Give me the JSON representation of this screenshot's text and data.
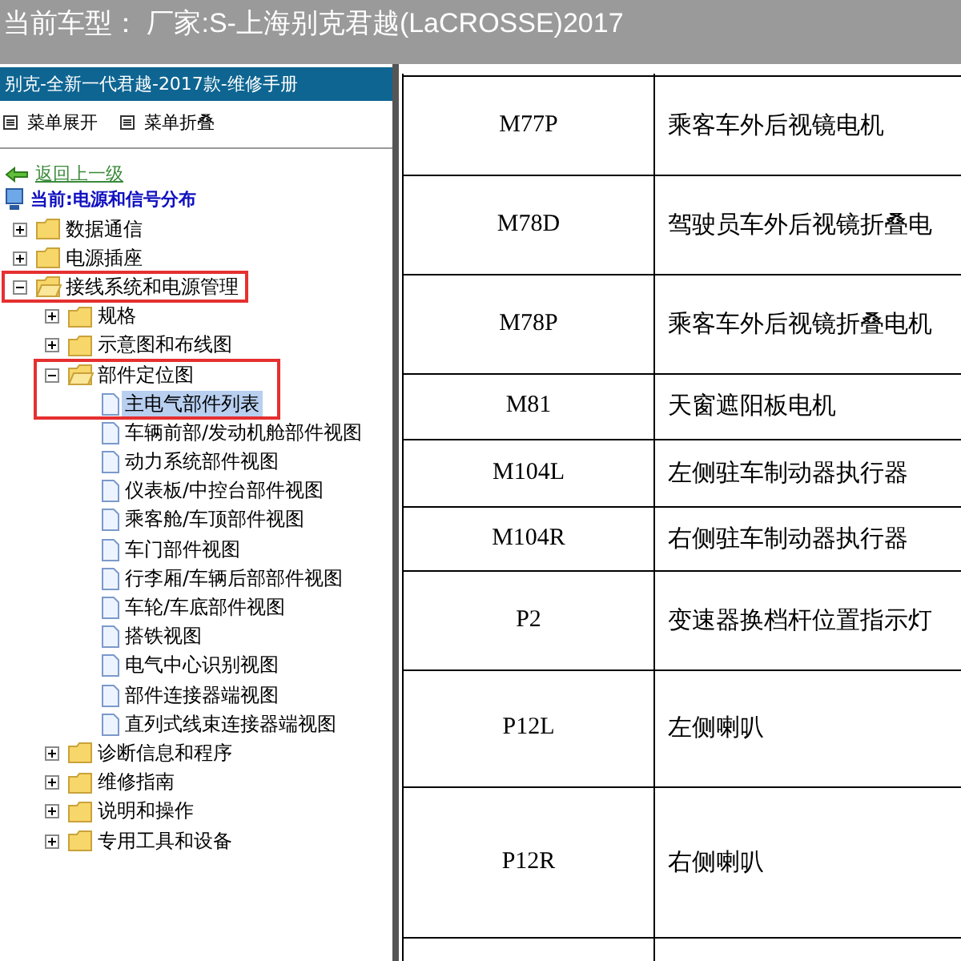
{
  "top_bar": {
    "title": "当前车型：  厂家:S-上海别克君越(LaCROSSE)2017"
  },
  "sidebar": {
    "title": "别克-全新一代君越-2017款-维修手册",
    "menu_actions": [
      {
        "label": "菜单展开"
      },
      {
        "label": "菜单折叠"
      }
    ],
    "back_link": "返回上一级",
    "current": "当前:电源和信号分布",
    "tree": [
      {
        "label": "数据通信",
        "kind": "folder",
        "expanded": false,
        "annotated": false
      },
      {
        "label": "电源插座",
        "kind": "folder",
        "expanded": false,
        "annotated": false
      },
      {
        "label": "接线系统和电源管理",
        "kind": "folder",
        "expanded": true,
        "annotated": true,
        "children": [
          {
            "label": "规格",
            "kind": "folder",
            "expanded": false,
            "annotated": false
          },
          {
            "label": "示意图和布线图",
            "kind": "folder",
            "expanded": false,
            "annotated": false
          },
          {
            "label": "部件定位图",
            "kind": "folder",
            "expanded": true,
            "annotated": true,
            "children": [
              {
                "label": "主电气部件列表",
                "kind": "page",
                "selected": true,
                "annotated": true
              },
              {
                "label": "车辆前部/发动机舱部件视图",
                "kind": "page",
                "selected": false,
                "annotated": false
              },
              {
                "label": "动力系统部件视图",
                "kind": "page",
                "selected": false,
                "annotated": false
              },
              {
                "label": "仪表板/中控台部件视图",
                "kind": "page",
                "selected": false,
                "annotated": false
              },
              {
                "label": "乘客舱/车顶部件视图",
                "kind": "page",
                "selected": false,
                "annotated": false
              },
              {
                "label": "车门部件视图",
                "kind": "page",
                "selected": false,
                "annotated": false
              },
              {
                "label": "行李厢/车辆后部部件视图",
                "kind": "page",
                "selected": false,
                "annotated": false
              },
              {
                "label": "车轮/车底部件视图",
                "kind": "page",
                "selected": false,
                "annotated": false
              },
              {
                "label": "搭铁视图",
                "kind": "page",
                "selected": false,
                "annotated": false
              },
              {
                "label": "电气中心识别视图",
                "kind": "page",
                "selected": false,
                "annotated": false
              },
              {
                "label": "部件连接器端视图",
                "kind": "page",
                "selected": false,
                "annotated": false
              },
              {
                "label": "直列式线束连接器端视图",
                "kind": "page",
                "selected": false,
                "annotated": false
              }
            ]
          },
          {
            "label": "诊断信息和程序",
            "kind": "folder",
            "expanded": false,
            "annotated": false
          },
          {
            "label": "维修指南",
            "kind": "folder",
            "expanded": false,
            "annotated": false
          },
          {
            "label": "说明和操作",
            "kind": "folder",
            "expanded": false,
            "annotated": false
          },
          {
            "label": "专用工具和设备",
            "kind": "folder",
            "expanded": false,
            "annotated": false
          }
        ]
      }
    ]
  },
  "table": {
    "rows": [
      {
        "code": "M77P",
        "description": "乘客车外后视镜电机"
      },
      {
        "code": "M78D",
        "description": "驾驶员车外后视镜折叠电"
      },
      {
        "code": "M78P",
        "description": "乘客车外后视镜折叠电机"
      },
      {
        "code": "M81",
        "description": "天窗遮阳板电机"
      },
      {
        "code": "M104L",
        "description": "左侧驻车制动器执行器"
      },
      {
        "code": "M104R",
        "description": "右侧驻车制动器执行器"
      },
      {
        "code": "P2",
        "description": "变速器换档杆位置指示灯"
      },
      {
        "code": "P12L",
        "description": "左侧喇叭"
      },
      {
        "code": "P12R",
        "description": "右侧喇叭"
      }
    ]
  }
}
